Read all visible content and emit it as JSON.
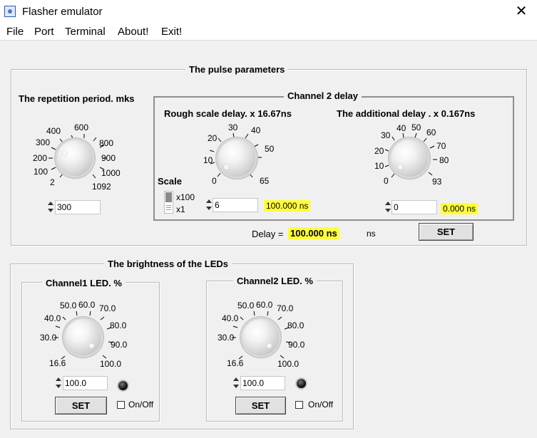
{
  "window": {
    "title": "Flasher emulator",
    "close_glyph": "✕"
  },
  "menu": [
    "File",
    "Port",
    "Terminal",
    "About!",
    "Exit!"
  ],
  "pulse": {
    "title": "The pulse parameters",
    "period": {
      "label": "The repetition period. mks",
      "ticks": [
        "400",
        "600",
        "300",
        "800",
        "200",
        "900",
        "100",
        "1000",
        "2",
        "1092"
      ],
      "value": "300"
    },
    "channel2": {
      "title": "Channel 2 delay",
      "rough": {
        "label": "Rough scale delay. x 16.67ns",
        "ticks": [
          "30",
          "40",
          "20",
          "50",
          "10",
          "0",
          "65"
        ],
        "value": "6",
        "result": "100.000 ns"
      },
      "scale": {
        "label": "Scale",
        "options": [
          "x100",
          "x1"
        ],
        "selected": "x100"
      },
      "additional": {
        "label": "The additional delay . x 0.167ns",
        "ticks": [
          "40",
          "50",
          "30",
          "60",
          "70",
          "20",
          "80",
          "10",
          "0",
          "93"
        ],
        "value": "0",
        "result": "0.000 ns"
      }
    },
    "delay": {
      "label": "Delay =",
      "value": "100.000 ns",
      "unit": "ns"
    },
    "set_label": "SET"
  },
  "brightness": {
    "title": "The brightness of the LEDs",
    "channel1": {
      "label": "Channel1 LED. %",
      "ticks": [
        "50.0",
        "60.0",
        "70.0",
        "40.0",
        "80.0",
        "30.0",
        "90.0",
        "16.6",
        "100.0"
      ],
      "value": "100.0",
      "set_label": "SET",
      "onoff_label": "On/Off",
      "on": false
    },
    "channel2": {
      "label": "Channel2 LED. %",
      "ticks": [
        "50.0",
        "60.0",
        "70.0",
        "40.0",
        "80.0",
        "30.0",
        "90.0",
        "16.6",
        "100.0"
      ],
      "value": "100.0",
      "set_label": "SET",
      "onoff_label": "On/Off",
      "on": false
    }
  },
  "colors": {
    "highlight": "#ffff3a",
    "window_bg": "#f0f0f0"
  }
}
